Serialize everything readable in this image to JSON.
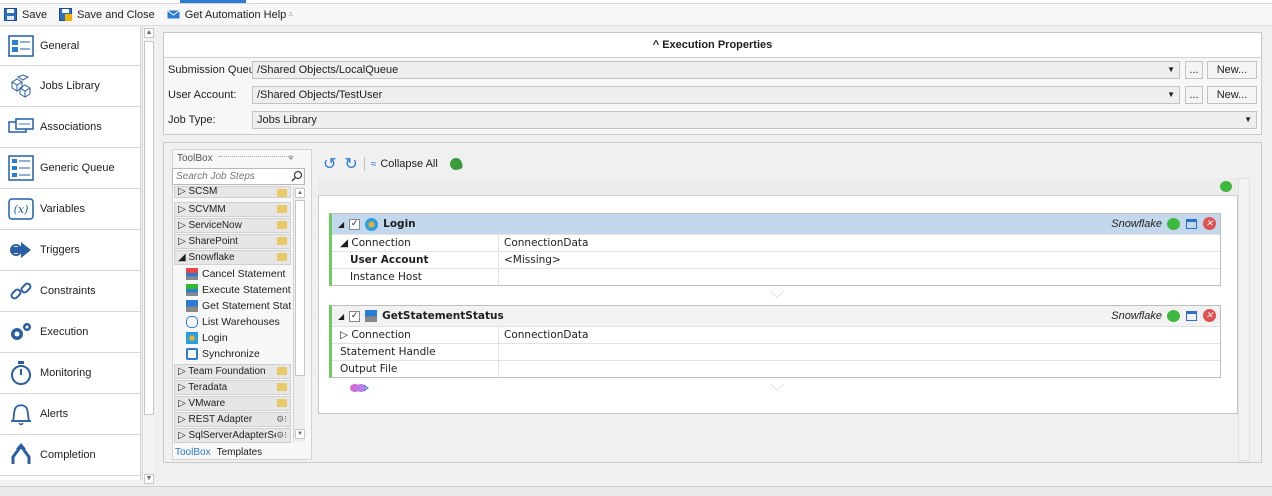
{
  "toolbar": {
    "save": "Save",
    "save_close": "Save and Close",
    "help": "Get Automation Help",
    "help_more": "⩡"
  },
  "nav": [
    {
      "label": "General",
      "icon": "general-icon"
    },
    {
      "label": "Jobs Library",
      "icon": "jobs-library-icon"
    },
    {
      "label": "Associations",
      "icon": "associations-icon"
    },
    {
      "label": "Generic Queue",
      "icon": "generic-queue-icon"
    },
    {
      "label": "Variables",
      "icon": "variables-icon"
    },
    {
      "label": "Triggers",
      "icon": "triggers-icon"
    },
    {
      "label": "Constraints",
      "icon": "constraints-icon"
    },
    {
      "label": "Execution",
      "icon": "execution-icon"
    },
    {
      "label": "Monitoring",
      "icon": "monitoring-icon"
    },
    {
      "label": "Alerts",
      "icon": "alerts-icon"
    },
    {
      "label": "Completion",
      "icon": "completion-icon"
    }
  ],
  "exec": {
    "title": "^ Execution Properties",
    "submission_label": "Submission Queue:",
    "submission_value": "/Shared Objects/LocalQueue",
    "user_label": "User Account:",
    "user_value": "/Shared Objects/TestUser",
    "jobtype_label": "Job Type:",
    "jobtype_value": "Jobs Library",
    "ellipsis": "...",
    "new_label": "New..."
  },
  "toolbox": {
    "title": "ToolBox",
    "search_placeholder": "Search Job Steps",
    "groups_top": [
      "SCSM",
      "SCVMM",
      "ServiceNow",
      "SharePoint",
      "Snowflake"
    ],
    "items": [
      "Cancel Statement",
      "Execute Statement",
      "Get Statement Stat",
      "List Warehouses",
      "Login",
      "Synchronize"
    ],
    "groups_bottom": [
      "Team Foundation",
      "Teradata",
      "VMware",
      "REST Adapter",
      "SqlServerAdapterSe"
    ],
    "tab_toolbox": "ToolBox",
    "tab_templates": "Templates"
  },
  "designer": {
    "collapse_all": "Collapse All",
    "steps": [
      {
        "title": "Login",
        "adapter": "Snowflake",
        "rows": [
          {
            "key": "◢ Connection",
            "value": "ConnectionData",
            "bold": false
          },
          {
            "key": "User Account",
            "value": "<Missing>",
            "bold": true
          },
          {
            "key": "Instance Host",
            "value": "",
            "bold": false
          }
        ]
      },
      {
        "title": "GetStatementStatus",
        "adapter": "Snowflake",
        "rows": [
          {
            "key": "▷ Connection",
            "value": "ConnectionData",
            "bold": false
          },
          {
            "key": "Statement Handle",
            "value": "",
            "bold": false
          },
          {
            "key": "Output File",
            "value": "",
            "bold": false
          }
        ]
      }
    ]
  },
  "colors": {
    "accent": "#2b7cd3",
    "step_border": "#6ccc5c",
    "selected_header": "#c3d8ec"
  }
}
